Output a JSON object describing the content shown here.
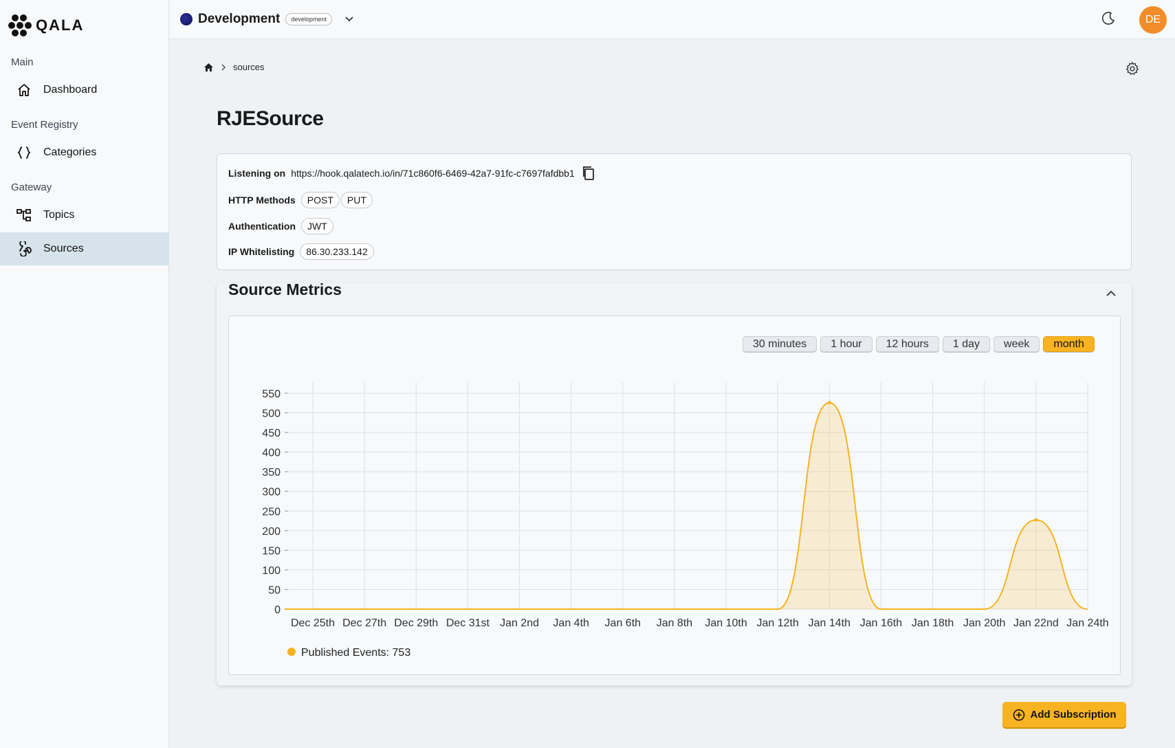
{
  "app": {
    "logo_text": "QALA"
  },
  "sidebar": {
    "sections": [
      {
        "title": "Main",
        "items": [
          {
            "label": "Dashboard",
            "icon": "home-icon"
          }
        ]
      },
      {
        "title": "Event Registry",
        "items": [
          {
            "label": "Categories",
            "icon": "braces-icon"
          }
        ]
      },
      {
        "title": "Gateway",
        "items": [
          {
            "label": "Topics",
            "icon": "topics-icon"
          },
          {
            "label": "Sources",
            "icon": "webhook-icon",
            "active": true
          }
        ]
      }
    ]
  },
  "header": {
    "env_name": "Development",
    "env_badge": "development",
    "avatar_initials": "DE",
    "avatar_color": "#f28c28"
  },
  "breadcrumb": {
    "current": "sources"
  },
  "page": {
    "title": "RJESource"
  },
  "info": {
    "listening_label": "Listening on",
    "listening_url": "https://hook.qalatech.io/in/71c860f6-6469-42a7-91fc-c7697fafdbb1",
    "http_label": "HTTP Methods",
    "http_methods": [
      "POST",
      "PUT"
    ],
    "auth_label": "Authentication",
    "auth_value": "JWT",
    "ip_label": "IP Whitelisting",
    "ip_value": "86.30.233.142"
  },
  "metrics": {
    "title": "Source Metrics",
    "ranges": [
      "30 minutes",
      "1 hour",
      "12 hours",
      "1 day",
      "week",
      "month"
    ],
    "active_range": "month",
    "legend_text": "Published Events: 753"
  },
  "chart_data": {
    "type": "area",
    "x": [
      "Dec 25th",
      "Dec 27th",
      "Dec 29th",
      "Dec 31st",
      "Jan 2nd",
      "Jan 4th",
      "Jan 6th",
      "Jan 8th",
      "Jan 10th",
      "Jan 12th",
      "Jan 14th",
      "Jan 16th",
      "Jan 18th",
      "Jan 20th",
      "Jan 22nd",
      "Jan 24th"
    ],
    "series": [
      {
        "name": "Published Events",
        "values": [
          0,
          0,
          0,
          0,
          0,
          0,
          0,
          0,
          0,
          0,
          526,
          0,
          0,
          0,
          227,
          0
        ],
        "color": "#f7b322"
      }
    ],
    "yticks": [
      0,
      50,
      100,
      150,
      200,
      250,
      300,
      350,
      400,
      450,
      500,
      550
    ],
    "ylim": [
      0,
      560
    ],
    "grid": true,
    "legend_position": "bottom-left"
  },
  "actions": {
    "add_subscription": "Add Subscription"
  },
  "colors": {
    "accent": "#f7b322",
    "sidebar_active": "#d6e3ea"
  }
}
